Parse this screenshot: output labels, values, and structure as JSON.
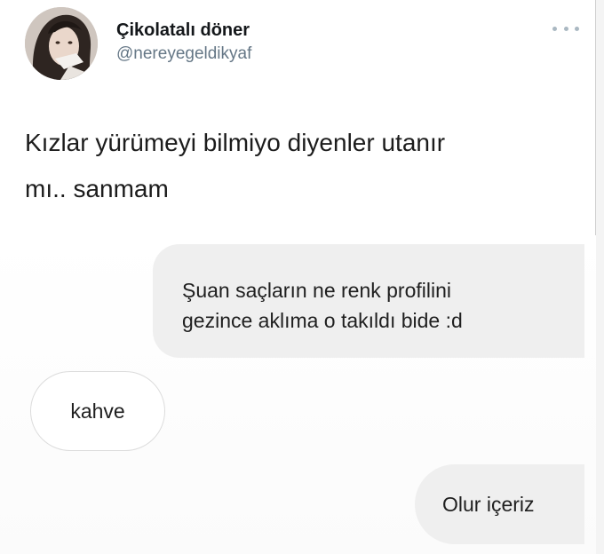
{
  "tweet": {
    "author": {
      "display_name": "Çikolatalı döner",
      "handle": "@nereyegeldikyaf",
      "avatar_icon": "profile-photo"
    },
    "more_icon": "more-horizontal-icon",
    "text": "Kızlar yürümeyi bilmiyo diyenler utanır\nmı.. sanmam"
  },
  "chat": {
    "messages": [
      {
        "side": "right",
        "text": "Şuan saçların ne renk profilini\ngezince aklıma o takıldı bide :d"
      },
      {
        "side": "left",
        "text": "kahve"
      },
      {
        "side": "right",
        "text": "Olur içeriz"
      }
    ]
  },
  "colors": {
    "name_text": "#14171a",
    "handle_text": "#657786",
    "sent_bubble": "#efefef",
    "received_bubble_border": "#dcdcdc"
  }
}
